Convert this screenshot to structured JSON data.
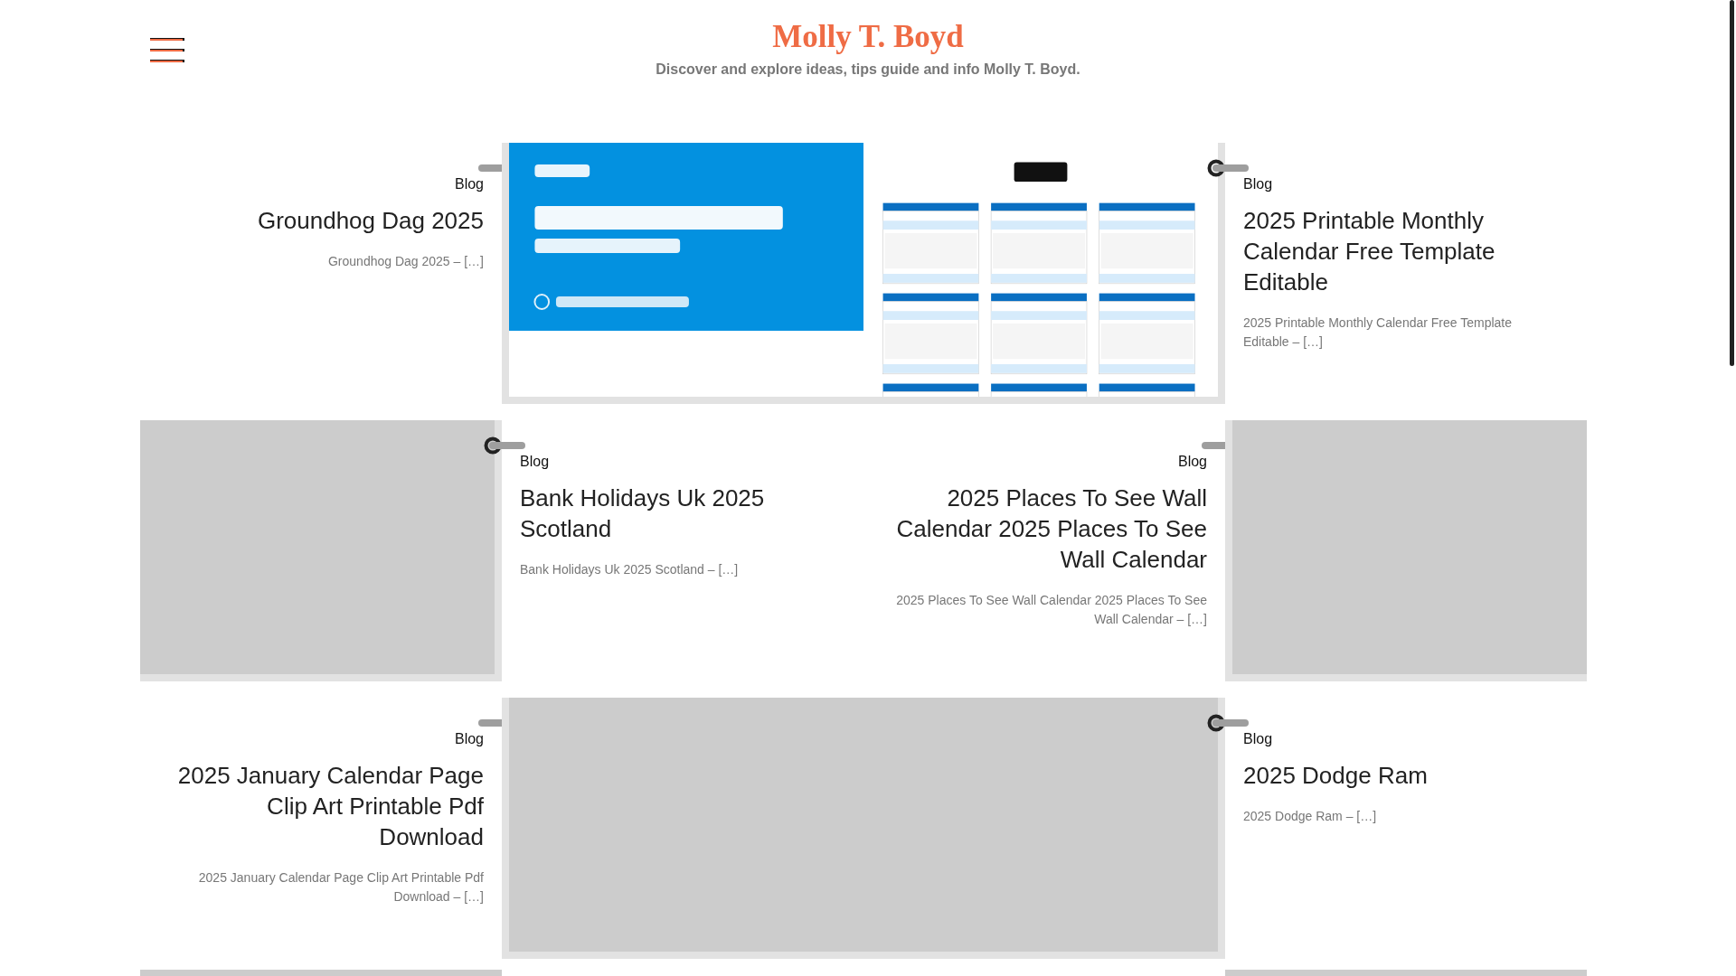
{
  "site": {
    "title": "Molly T. Boyd",
    "tagline": "Discover and explore ideas, tips guide and info Molly T. Boyd."
  },
  "posts": [
    {
      "category": "Blog",
      "title": "Groundhog Dag 2025",
      "excerpt": "Groundhog Dag 2025 – […]",
      "kind": "left",
      "image": {
        "kind": "banner"
      }
    },
    {
      "category": "Blog",
      "title": "2025 Printable Monthly Calendar Free Template Editable",
      "excerpt": "2025 Printable Monthly Calendar Free Template Editable – […]",
      "kind": "right",
      "image": {
        "kind": "calendar"
      }
    },
    {
      "category": "Blog",
      "title": "Bank Holidays Uk 2025 Scotland",
      "excerpt": "Bank Holidays Uk 2025 Scotland – […]",
      "kind": "right",
      "image": {
        "kind": "placeholder"
      }
    },
    {
      "category": "Blog",
      "title": "2025 Places To See Wall Calendar 2025 Places To See Wall Calendar",
      "excerpt": "2025 Places To See Wall Calendar 2025 Places To See Wall Calendar – […]",
      "kind": "left",
      "image": {
        "kind": "placeholder"
      }
    },
    {
      "category": "Blog",
      "title": "2025 January Calendar Page Clip Art Printable Pdf Download",
      "excerpt": "2025 January Calendar Page Clip Art Printable Pdf Download – […]",
      "kind": "left",
      "image": {
        "kind": "placeholder"
      }
    },
    {
      "category": "Blog",
      "title": "2025 Dodge Ram",
      "excerpt": "2025 Dodge Ram – […]",
      "kind": "right",
      "image": {
        "kind": "placeholder"
      }
    }
  ],
  "partial_row": [
    {
      "kind": "placeholder"
    },
    {
      "kind": "placeholder"
    }
  ]
}
